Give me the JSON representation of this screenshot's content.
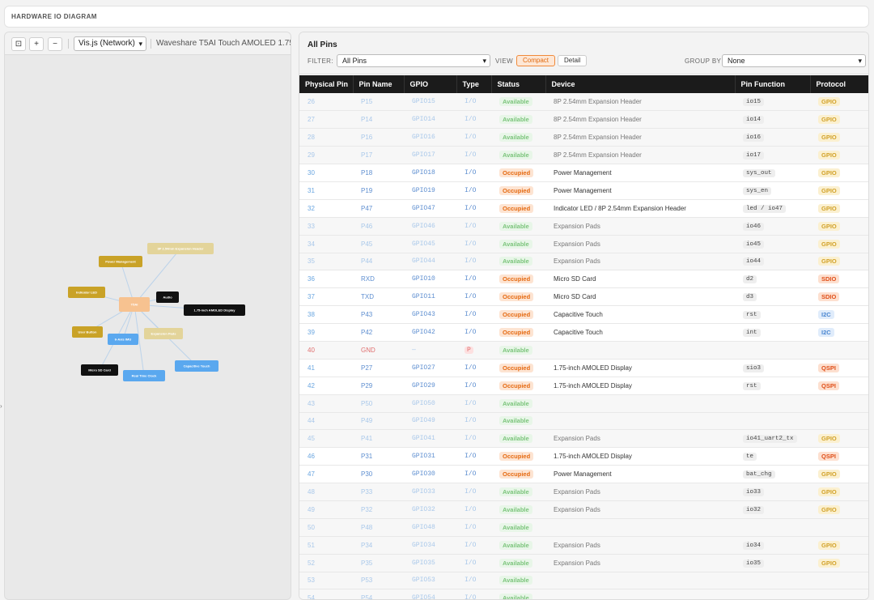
{
  "app": {
    "title": "HARDWARE IO DIAGRAM"
  },
  "toolbar": {
    "fit_label": "⊡",
    "zoom_in_label": "+",
    "zoom_out_label": "−",
    "library_value": "Vis.js (Network)",
    "device_name": "Waveshare T5AI Touch AMOLED 1.75\""
  },
  "right": {
    "title": "All Pins",
    "filter_label": "FILTER:",
    "filter_value": "All Pins",
    "view_label": "VIEW",
    "view_compact": "Compact",
    "view_detail": "Detail",
    "groupby_label": "GROUP BY",
    "groupby_value": "None"
  },
  "columns": [
    "Physical Pin",
    "Pin Name",
    "GPIO",
    "Type",
    "Status",
    "Device",
    "Pin Function",
    "Protocol"
  ],
  "rows": [
    {
      "pin": "26",
      "name": "P15",
      "gpio": "GPIO15",
      "type": "I/O",
      "status": "Available",
      "device": "8P 2.54mm Expansion Header",
      "func": "io15",
      "proto": "GPIO"
    },
    {
      "pin": "27",
      "name": "P14",
      "gpio": "GPIO14",
      "type": "I/O",
      "status": "Available",
      "device": "8P 2.54mm Expansion Header",
      "func": "io14",
      "proto": "GPIO"
    },
    {
      "pin": "28",
      "name": "P16",
      "gpio": "GPIO16",
      "type": "I/O",
      "status": "Available",
      "device": "8P 2.54mm Expansion Header",
      "func": "io16",
      "proto": "GPIO"
    },
    {
      "pin": "29",
      "name": "P17",
      "gpio": "GPIO17",
      "type": "I/O",
      "status": "Available",
      "device": "8P 2.54mm Expansion Header",
      "func": "io17",
      "proto": "GPIO"
    },
    {
      "pin": "30",
      "name": "P18",
      "gpio": "GPIO18",
      "type": "I/O",
      "status": "Occupied",
      "device": "Power Management",
      "func": "sys_out",
      "proto": "GPIO"
    },
    {
      "pin": "31",
      "name": "P19",
      "gpio": "GPIO19",
      "type": "I/O",
      "status": "Occupied",
      "device": "Power Management",
      "func": "sys_en",
      "proto": "GPIO"
    },
    {
      "pin": "32",
      "name": "P47",
      "gpio": "GPIO47",
      "type": "I/O",
      "status": "Occupied",
      "device": "Indicator LED / 8P 2.54mm Expansion Header",
      "func": "led / io47",
      "proto": "GPIO"
    },
    {
      "pin": "33",
      "name": "P46",
      "gpio": "GPIO46",
      "type": "I/O",
      "status": "Available",
      "device": "Expansion Pads",
      "func": "io46",
      "proto": "GPIO"
    },
    {
      "pin": "34",
      "name": "P45",
      "gpio": "GPIO45",
      "type": "I/O",
      "status": "Available",
      "device": "Expansion Pads",
      "func": "io45",
      "proto": "GPIO"
    },
    {
      "pin": "35",
      "name": "P44",
      "gpio": "GPIO44",
      "type": "I/O",
      "status": "Available",
      "device": "Expansion Pads",
      "func": "io44",
      "proto": "GPIO"
    },
    {
      "pin": "36",
      "name": "RXD",
      "gpio": "GPIO10",
      "type": "I/O",
      "status": "Occupied",
      "device": "Micro SD Card",
      "func": "d2",
      "proto": "SDIO"
    },
    {
      "pin": "37",
      "name": "TXD",
      "gpio": "GPIO11",
      "type": "I/O",
      "status": "Occupied",
      "device": "Micro SD Card",
      "func": "d3",
      "proto": "SDIO"
    },
    {
      "pin": "38",
      "name": "P43",
      "gpio": "GPIO43",
      "type": "I/O",
      "status": "Occupied",
      "device": "Capacitive Touch",
      "func": "rst",
      "proto": "I2C"
    },
    {
      "pin": "39",
      "name": "P42",
      "gpio": "GPIO42",
      "type": "I/O",
      "status": "Occupied",
      "device": "Capacitive Touch",
      "func": "int",
      "proto": "I2C"
    },
    {
      "pin": "40",
      "name": "GND",
      "gpio": "—",
      "type": "P",
      "status": "Available",
      "device": "",
      "func": "",
      "proto": ""
    },
    {
      "pin": "41",
      "name": "P27",
      "gpio": "GPIO27",
      "type": "I/O",
      "status": "Occupied",
      "device": "1.75-inch AMOLED Display",
      "func": "sio3",
      "proto": "QSPI"
    },
    {
      "pin": "42",
      "name": "P29",
      "gpio": "GPIO29",
      "type": "I/O",
      "status": "Occupied",
      "device": "1.75-inch AMOLED Display",
      "func": "rst",
      "proto": "QSPI"
    },
    {
      "pin": "43",
      "name": "P50",
      "gpio": "GPIO50",
      "type": "I/O",
      "status": "Available",
      "device": "",
      "func": "",
      "proto": ""
    },
    {
      "pin": "44",
      "name": "P49",
      "gpio": "GPIO49",
      "type": "I/O",
      "status": "Available",
      "device": "",
      "func": "",
      "proto": ""
    },
    {
      "pin": "45",
      "name": "P41",
      "gpio": "GPIO41",
      "type": "I/O",
      "status": "Available",
      "device": "Expansion Pads",
      "func": "io41_uart2_tx",
      "proto": "GPIO"
    },
    {
      "pin": "46",
      "name": "P31",
      "gpio": "GPIO31",
      "type": "I/O",
      "status": "Occupied",
      "device": "1.75-inch AMOLED Display",
      "func": "te",
      "proto": "QSPI"
    },
    {
      "pin": "47",
      "name": "P30",
      "gpio": "GPIO30",
      "type": "I/O",
      "status": "Occupied",
      "device": "Power Management",
      "func": "bat_chg",
      "proto": "GPIO"
    },
    {
      "pin": "48",
      "name": "P33",
      "gpio": "GPIO33",
      "type": "I/O",
      "status": "Available",
      "device": "Expansion Pads",
      "func": "io33",
      "proto": "GPIO"
    },
    {
      "pin": "49",
      "name": "P32",
      "gpio": "GPIO32",
      "type": "I/O",
      "status": "Available",
      "device": "Expansion Pads",
      "func": "io32",
      "proto": "GPIO"
    },
    {
      "pin": "50",
      "name": "P48",
      "gpio": "GPIO48",
      "type": "I/O",
      "status": "Available",
      "device": "",
      "func": "",
      "proto": ""
    },
    {
      "pin": "51",
      "name": "P34",
      "gpio": "GPIO34",
      "type": "I/O",
      "status": "Available",
      "device": "Expansion Pads",
      "func": "io34",
      "proto": "GPIO"
    },
    {
      "pin": "52",
      "name": "P35",
      "gpio": "GPIO35",
      "type": "I/O",
      "status": "Available",
      "device": "Expansion Pads",
      "func": "io35",
      "proto": "GPIO"
    },
    {
      "pin": "53",
      "name": "P53",
      "gpio": "GPIO53",
      "type": "I/O",
      "status": "Available",
      "device": "",
      "func": "",
      "proto": ""
    },
    {
      "pin": "54",
      "name": "P54",
      "gpio": "GPIO54",
      "type": "I/O",
      "status": "Available",
      "device": "",
      "func": "",
      "proto": ""
    }
  ],
  "network": {
    "nodes": [
      {
        "id": "mcu",
        "label": "T5AI",
        "color": "#f7c290",
        "text": "#fff"
      },
      {
        "id": "pm",
        "label": "Power Management",
        "color": "#c9a227",
        "text": "#fff"
      },
      {
        "id": "hdr",
        "label": "8P 2.54mm Expansion Header",
        "color": "#e3d49a",
        "text": "#fff"
      },
      {
        "id": "led",
        "label": "Indicator LED",
        "color": "#c9a227",
        "text": "#fff"
      },
      {
        "id": "audio",
        "label": "Audio",
        "color": "#111111",
        "text": "#fff"
      },
      {
        "id": "amoled",
        "label": "1.75-inch AMOLED Display",
        "color": "#111111",
        "text": "#fff"
      },
      {
        "id": "user",
        "label": "User Button",
        "color": "#c9a227",
        "text": "#fff"
      },
      {
        "id": "imu",
        "label": "6-Axis IMU",
        "color": "#5aa8ef",
        "text": "#fff"
      },
      {
        "id": "pads",
        "label": "Expansion Pads",
        "color": "#e3d49a",
        "text": "#fff"
      },
      {
        "id": "sd",
        "label": "Micro SD Card",
        "color": "#111111",
        "text": "#fff"
      },
      {
        "id": "rtc",
        "label": "Real Time Clock",
        "color": "#5aa8ef",
        "text": "#fff"
      },
      {
        "id": "touch",
        "label": "Capacitive Touch",
        "color": "#5aa8ef",
        "text": "#fff"
      }
    ],
    "edges": [
      {
        "from": "mcu",
        "to": "pm"
      },
      {
        "from": "mcu",
        "to": "hdr"
      },
      {
        "from": "mcu",
        "to": "led"
      },
      {
        "from": "mcu",
        "to": "audio"
      },
      {
        "from": "mcu",
        "to": "amoled"
      },
      {
        "from": "mcu",
        "to": "user"
      },
      {
        "from": "mcu",
        "to": "imu"
      },
      {
        "from": "mcu",
        "to": "pads"
      },
      {
        "from": "mcu",
        "to": "sd"
      },
      {
        "from": "mcu",
        "to": "rtc"
      },
      {
        "from": "mcu",
        "to": "touch"
      }
    ]
  }
}
